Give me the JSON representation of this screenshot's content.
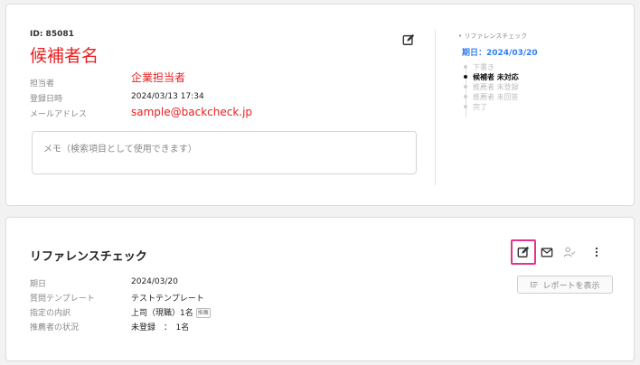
{
  "candidate": {
    "id_label": "ID: 85081",
    "name": "候補者名",
    "fields": {
      "owner_label": "担当者",
      "owner_value": "企業担当者",
      "registered_label": "登録日時",
      "registered_value": "2024/03/13 17:34",
      "email_label": "メールアドレス",
      "email_value": "sample@backcheck.jp"
    },
    "memo_placeholder": "メモ（検索項目として使用できます）"
  },
  "ref_status": {
    "title": "• リファレンスチェック",
    "due": "期日：2024/03/20",
    "steps": [
      "下書き",
      "候補者 未対応",
      "推薦者 未登録",
      "推薦者 未回答",
      "完了"
    ],
    "active_step": 1
  },
  "ref_check": {
    "title": "リファレンスチェック",
    "due_label": "期日",
    "due_value": "2024/03/20",
    "template_label": "質問テンプレート",
    "template_value": "テストテンプレート",
    "breakdown_label": "指定の内訳",
    "breakdown_value": "上司（現職）1名",
    "breakdown_badge": "推薦",
    "status_label": "推薦者の状況",
    "status_value": "未登録　：　1名",
    "report_button": "レポートを表示"
  },
  "icons": {
    "edit_candidate": "edit-icon",
    "edit_ref": "edit-icon",
    "mail": "mail-icon",
    "assign": "user-check-icon",
    "more": "more-vertical-icon",
    "report": "list-icon"
  },
  "colors": {
    "accent_red": "#e82020",
    "link_blue": "#2f7ef5",
    "highlight": "#e0358c"
  }
}
